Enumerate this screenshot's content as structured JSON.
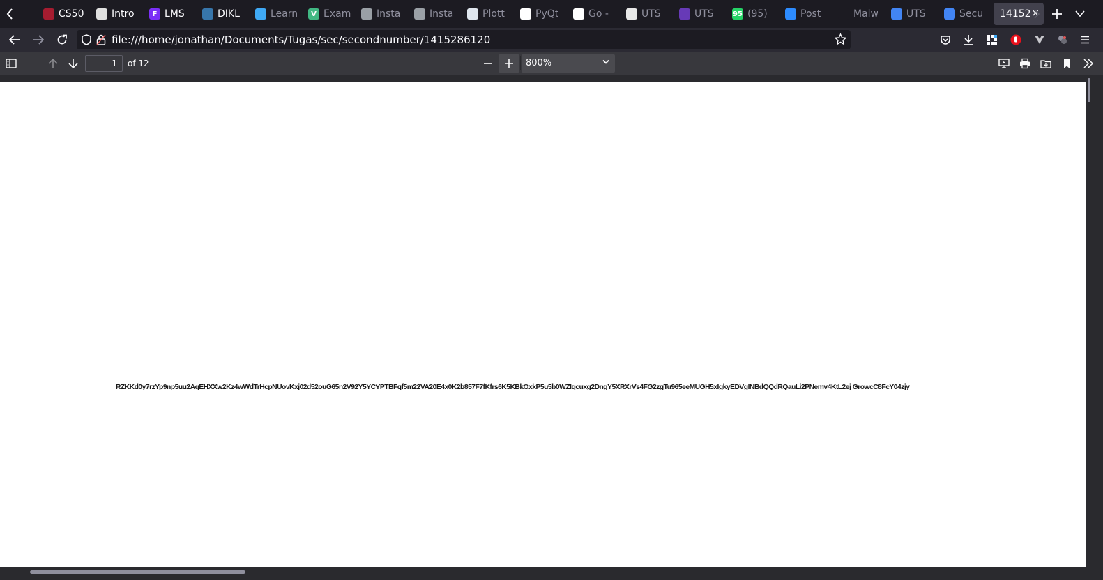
{
  "tabs": [
    {
      "label": "",
      "icon": "red-shield-icon",
      "color": "#c21b2f",
      "short": "",
      "faded": true
    },
    {
      "label": "CS50",
      "icon": "cs50-shield-icon",
      "color": "#a51c30",
      "short": "",
      "faded": false
    },
    {
      "label": "Intro",
      "icon": "grid-logo-icon",
      "color": "#e0e0e0",
      "short": "",
      "faded": false
    },
    {
      "label": "LMS",
      "icon": "lms-logo-icon",
      "color": "#7b2ff7",
      "short": "F",
      "faded": false
    },
    {
      "label": "DIKL",
      "icon": "python-logo-icon",
      "color": "#3776ab",
      "short": "",
      "faded": false
    },
    {
      "label": "Learn",
      "icon": "arrow-logo-icon",
      "color": "#3fa9f5",
      "short": "",
      "faded": true
    },
    {
      "label": "Exam",
      "icon": "vue-logo-icon",
      "color": "#41b883",
      "short": "V",
      "faded": true
    },
    {
      "label": "Insta",
      "icon": "doc-icon",
      "color": "#9aa0a6",
      "short": "",
      "faded": true
    },
    {
      "label": "Insta",
      "icon": "doc-icon",
      "color": "#9aa0a6",
      "short": "",
      "faded": true
    },
    {
      "label": "Plott",
      "icon": "plotly-icon",
      "color": "#dfe6ee",
      "short": "",
      "faded": true
    },
    {
      "label": "PyQt",
      "icon": "pyqt-icon",
      "color": "#ffffff",
      "short": "",
      "faded": true
    },
    {
      "label": "Go -",
      "icon": "go-icon",
      "color": "#ffffff",
      "short": "",
      "faded": true
    },
    {
      "label": "UTS",
      "icon": "book-icon",
      "color": "#e8e8e8",
      "short": "",
      "faded": true
    },
    {
      "label": "UTS",
      "icon": "forms-icon",
      "color": "#673ab7",
      "short": "",
      "faded": true
    },
    {
      "label": "(95)",
      "icon": "whatsapp-icon",
      "color": "#25d366",
      "short": "95",
      "faded": true
    },
    {
      "label": "Post",
      "icon": "zoom-icon",
      "color": "#2d8cff",
      "short": "",
      "faded": true
    },
    {
      "label": "Malw",
      "icon": "check-icon",
      "color": "#1c1b22",
      "short": "",
      "faded": true
    },
    {
      "label": "UTS",
      "icon": "google-doc-icon",
      "color": "#4285f4",
      "short": "",
      "faded": true
    },
    {
      "label": "Secu",
      "icon": "google-doc-icon",
      "color": "#4285f4",
      "short": "",
      "faded": true
    }
  ],
  "active_tab": {
    "label": "14152"
  },
  "nav": {
    "url": "file:///home/jonathan/Documents/Tugas/sec/secondnumber/1415286120"
  },
  "pdf": {
    "page_number": "1",
    "page_total": "of 12",
    "zoom": "800%"
  },
  "document": {
    "text": "RZKKd0y7rzYp9np5uu2AqEHXXw2Kz4wWdTrHcpNUovKxj02d52ouG65n2V92Y5YCYPTBFqf5m22VA20E4x0K2b857F7fKfrs6K5KBkOxkP5u5b0WZIqcuxg2DngY5XRXrVs4FG2zgTu965eeMUGH5xIgkyEDVgINBdQQdRQauLi2PNemv4KtL2ej GrowcC8FcY04zjy"
  },
  "colors": {
    "chrome_dark": "#1c1b22",
    "toolbar": "#2b2a33",
    "pdf_toolbar": "#38383d",
    "page": "#ffffff"
  }
}
